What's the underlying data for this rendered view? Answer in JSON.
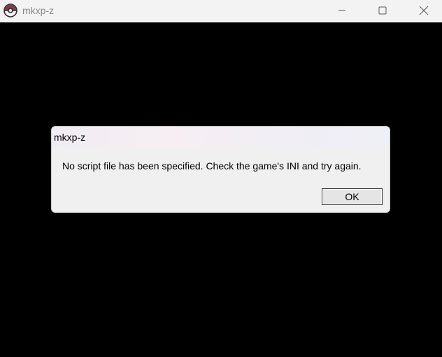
{
  "window": {
    "title": "mkxp-z",
    "app_icon": "pokeball-icon",
    "controls": {
      "minimize_icon": "minimize-icon",
      "maximize_icon": "maximize-icon",
      "close_icon": "close-icon"
    },
    "background_color": "#000000"
  },
  "dialog": {
    "title": "mkxp-z",
    "message": "No script file has been specified. Check the game's INI and try again.",
    "ok_label": "OK"
  }
}
